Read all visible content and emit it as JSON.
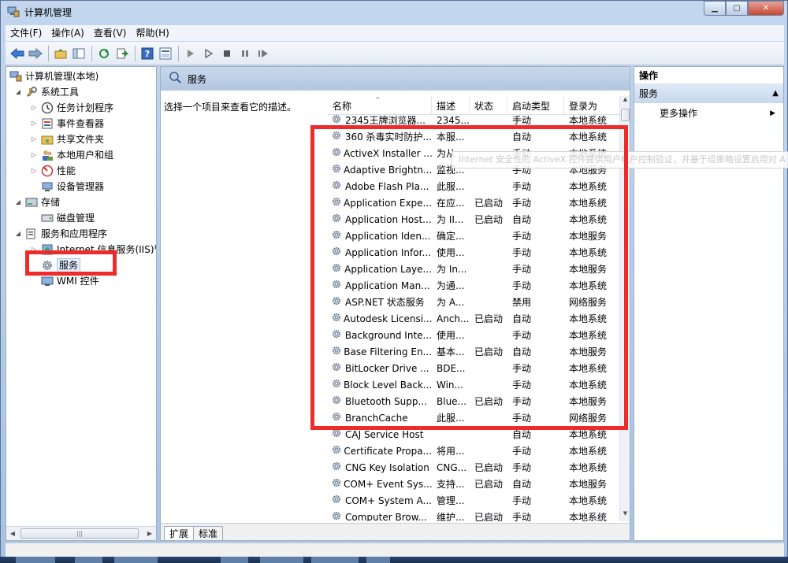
{
  "window": {
    "title": "计算机管理",
    "min_label": "▁",
    "max_label": "▢",
    "close_label": "✕"
  },
  "menu": [
    "文件(F)",
    "操作(A)",
    "查看(V)",
    "帮助(H)"
  ],
  "toolbar_icons": [
    "back-arrow-icon",
    "forward-arrow-icon",
    "up-folder-icon",
    "show-hide-tree-icon",
    "refresh-icon",
    "export-list-icon",
    "help-icon",
    "properties-view-icon",
    "start-service-icon",
    "start-service-alt-icon",
    "stop-service-icon",
    "pause-service-icon",
    "restart-service-icon"
  ],
  "tree": {
    "root": "计算机管理(本地)",
    "system_tools": "系统工具",
    "task_scheduler": "任务计划程序",
    "event_viewer": "事件查看器",
    "shared_folders": "共享文件夹",
    "local_users": "本地用户和组",
    "performance": "性能",
    "device_manager": "设备管理器",
    "storage": "存储",
    "disk_management": "磁盘管理",
    "services_apps": "服务和应用程序",
    "iis": "Internet 信息服务(IIS)管",
    "services": "服务",
    "wmi": "WMI 控件"
  },
  "center": {
    "header_title": "服务",
    "description_hint": "选择一个项目来查看它的描述。",
    "columns": [
      "名称",
      "描述",
      "状态",
      "启动类型",
      "登录为"
    ],
    "rows": [
      {
        "name": "2345王牌浏览器...",
        "desc": "2345...",
        "status": "",
        "startup": "手动",
        "logon": "本地系统"
      },
      {
        "name": "360 杀毒实时防护...",
        "desc": "本服...",
        "status": "",
        "startup": "自动",
        "logon": "本地系统"
      },
      {
        "name": "ActiveX Installer ...",
        "desc": "为从 ...",
        "status": "",
        "startup": "手动",
        "logon": "本地系统"
      },
      {
        "name": "Adaptive Brightn...",
        "desc": "监视...",
        "status": "",
        "startup": "手动",
        "logon": "本地服务"
      },
      {
        "name": "Adobe Flash Pla...",
        "desc": "此服...",
        "status": "",
        "startup": "手动",
        "logon": "本地系统"
      },
      {
        "name": "Application Expe...",
        "desc": "在应...",
        "status": "已启动",
        "startup": "手动",
        "logon": "本地系统"
      },
      {
        "name": "Application Host...",
        "desc": "为 II...",
        "status": "已启动",
        "startup": "自动",
        "logon": "本地系统"
      },
      {
        "name": "Application Iden...",
        "desc": "确定...",
        "status": "",
        "startup": "手动",
        "logon": "本地服务"
      },
      {
        "name": "Application Infor...",
        "desc": "使用...",
        "status": "",
        "startup": "手动",
        "logon": "本地系统"
      },
      {
        "name": "Application Laye...",
        "desc": "为 In...",
        "status": "",
        "startup": "手动",
        "logon": "本地服务"
      },
      {
        "name": "Application Man...",
        "desc": "为通...",
        "status": "",
        "startup": "手动",
        "logon": "本地系统"
      },
      {
        "name": "ASP.NET 状态服务",
        "desc": "为 A...",
        "status": "",
        "startup": "禁用",
        "logon": "网络服务"
      },
      {
        "name": "Autodesk Licensi...",
        "desc": "Anch...",
        "status": "已启动",
        "startup": "自动",
        "logon": "本地系统"
      },
      {
        "name": "Background Inte...",
        "desc": "使用...",
        "status": "",
        "startup": "手动",
        "logon": "本地系统"
      },
      {
        "name": "Base Filtering En...",
        "desc": "基本...",
        "status": "已启动",
        "startup": "自动",
        "logon": "本地服务"
      },
      {
        "name": "BitLocker Drive ...",
        "desc": "BDE...",
        "status": "",
        "startup": "手动",
        "logon": "本地系统"
      },
      {
        "name": "Block Level Back...",
        "desc": "Win...",
        "status": "",
        "startup": "手动",
        "logon": "本地系统"
      },
      {
        "name": "Bluetooth Supp...",
        "desc": "Blue...",
        "status": "已启动",
        "startup": "手动",
        "logon": "本地服务"
      },
      {
        "name": "BranchCache",
        "desc": "此服...",
        "status": "",
        "startup": "手动",
        "logon": "网络服务"
      },
      {
        "name": "CAJ Service Host",
        "desc": "",
        "status": "",
        "startup": "自动",
        "logon": "本地系统"
      },
      {
        "name": "Certificate Propa...",
        "desc": "将用...",
        "status": "",
        "startup": "手动",
        "logon": "本地系统"
      },
      {
        "name": "CNG Key Isolation",
        "desc": "CNG...",
        "status": "已启动",
        "startup": "手动",
        "logon": "本地系统"
      },
      {
        "name": "COM+ Event Sys...",
        "desc": "支持...",
        "status": "已启动",
        "startup": "自动",
        "logon": "本地服务"
      },
      {
        "name": "COM+ System A...",
        "desc": "管理...",
        "status": "",
        "startup": "手动",
        "logon": "本地系统"
      },
      {
        "name": "Computer Brow...",
        "desc": "维护...",
        "status": "已启动",
        "startup": "手动",
        "logon": "本地系统"
      }
    ],
    "tooltip": "Internet 安全性的 ActiveX 控件提供用户帐户控制验证，并基于组策略设置启用对 A",
    "tabs": [
      "扩展",
      "标准"
    ]
  },
  "actions": {
    "title": "操作",
    "group": "服务",
    "more": "更多操作"
  },
  "colors": {
    "annotation_red": "#ee2b2b",
    "header_blue": "#b2c6e0"
  }
}
